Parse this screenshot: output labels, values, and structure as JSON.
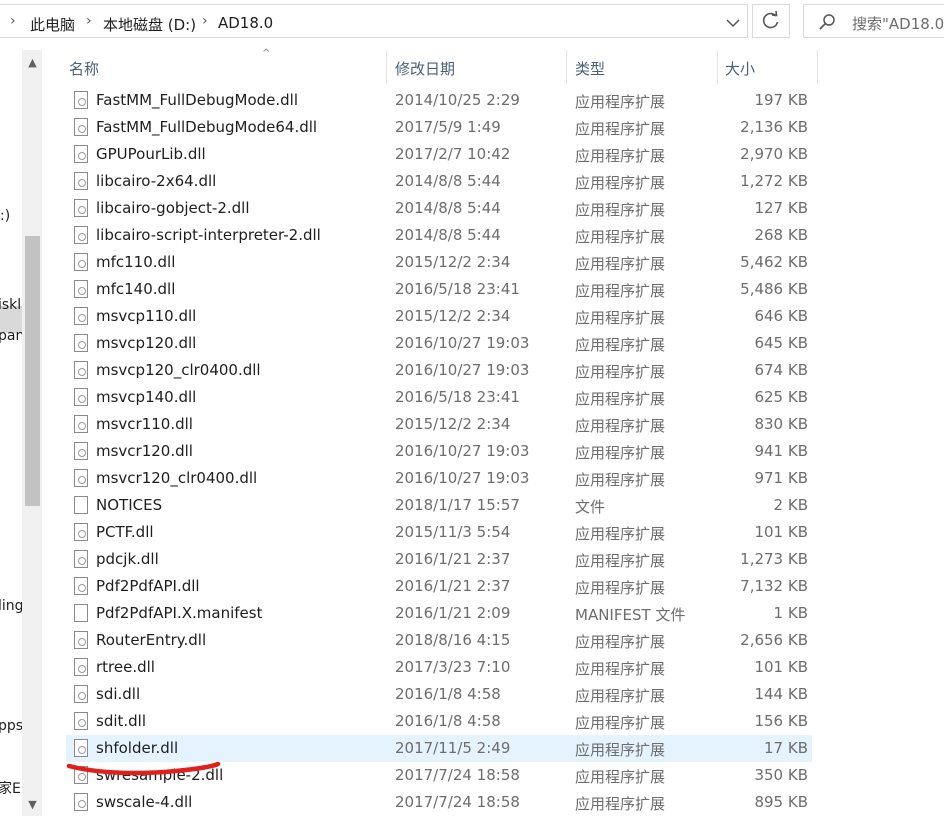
{
  "breadcrumb": {
    "items": [
      "此电脑",
      "本地磁盘 (D:)",
      "AD18.0"
    ]
  },
  "search": {
    "placeholder": "搜索\"AD18.0"
  },
  "nav_fragments": [
    ":)",
    "iskl",
    "pan",
    "ling",
    "pps",
    "家Ε"
  ],
  "columns": {
    "name": "名称",
    "modified": "修改日期",
    "type": "类型",
    "size": "大小"
  },
  "files": [
    {
      "name": "FastMM_FullDebugMode.dll",
      "date": "2014/10/25 2:29",
      "type": "应用程序扩展",
      "size": "197 KB"
    },
    {
      "name": "FastMM_FullDebugMode64.dll",
      "date": "2017/5/9 1:49",
      "type": "应用程序扩展",
      "size": "2,136 KB"
    },
    {
      "name": "GPUPourLib.dll",
      "date": "2017/2/7 10:42",
      "type": "应用程序扩展",
      "size": "2,970 KB"
    },
    {
      "name": "libcairo-2x64.dll",
      "date": "2014/8/8 5:44",
      "type": "应用程序扩展",
      "size": "1,272 KB"
    },
    {
      "name": "libcairo-gobject-2.dll",
      "date": "2014/8/8 5:44",
      "type": "应用程序扩展",
      "size": "127 KB"
    },
    {
      "name": "libcairo-script-interpreter-2.dll",
      "date": "2014/8/8 5:44",
      "type": "应用程序扩展",
      "size": "268 KB"
    },
    {
      "name": "mfc110.dll",
      "date": "2015/12/2 2:34",
      "type": "应用程序扩展",
      "size": "5,462 KB"
    },
    {
      "name": "mfc140.dll",
      "date": "2016/5/18 23:41",
      "type": "应用程序扩展",
      "size": "5,486 KB"
    },
    {
      "name": "msvcp110.dll",
      "date": "2015/12/2 2:34",
      "type": "应用程序扩展",
      "size": "646 KB"
    },
    {
      "name": "msvcp120.dll",
      "date": "2016/10/27 19:03",
      "type": "应用程序扩展",
      "size": "645 KB"
    },
    {
      "name": "msvcp120_clr0400.dll",
      "date": "2016/10/27 19:03",
      "type": "应用程序扩展",
      "size": "674 KB"
    },
    {
      "name": "msvcp140.dll",
      "date": "2016/5/18 23:41",
      "type": "应用程序扩展",
      "size": "625 KB"
    },
    {
      "name": "msvcr110.dll",
      "date": "2015/12/2 2:34",
      "type": "应用程序扩展",
      "size": "830 KB"
    },
    {
      "name": "msvcr120.dll",
      "date": "2016/10/27 19:03",
      "type": "应用程序扩展",
      "size": "941 KB"
    },
    {
      "name": "msvcr120_clr0400.dll",
      "date": "2016/10/27 19:03",
      "type": "应用程序扩展",
      "size": "971 KB"
    },
    {
      "name": "NOTICES",
      "date": "2018/1/17 15:57",
      "type": "文件",
      "size": "2 KB"
    },
    {
      "name": "PCTF.dll",
      "date": "2015/11/3 5:54",
      "type": "应用程序扩展",
      "size": "101 KB"
    },
    {
      "name": "pdcjk.dll",
      "date": "2016/1/21 2:37",
      "type": "应用程序扩展",
      "size": "1,273 KB"
    },
    {
      "name": "Pdf2PdfAPI.dll",
      "date": "2016/1/21 2:37",
      "type": "应用程序扩展",
      "size": "7,132 KB"
    },
    {
      "name": "Pdf2PdfAPI.X.manifest",
      "date": "2016/1/21 2:09",
      "type": "MANIFEST 文件",
      "size": "1 KB"
    },
    {
      "name": "RouterEntry.dll",
      "date": "2018/8/16 4:15",
      "type": "应用程序扩展",
      "size": "2,656 KB"
    },
    {
      "name": "rtree.dll",
      "date": "2017/3/23 7:10",
      "type": "应用程序扩展",
      "size": "101 KB"
    },
    {
      "name": "sdi.dll",
      "date": "2016/1/8 4:58",
      "type": "应用程序扩展",
      "size": "144 KB"
    },
    {
      "name": "sdit.dll",
      "date": "2016/1/8 4:58",
      "type": "应用程序扩展",
      "size": "156 KB"
    },
    {
      "name": "shfolder.dll",
      "date": "2017/11/5 2:49",
      "type": "应用程序扩展",
      "size": "17 KB",
      "selected": true
    },
    {
      "name": "swresample-2.dll",
      "date": "2017/7/24 18:58",
      "type": "应用程序扩展",
      "size": "350 KB"
    },
    {
      "name": "swscale-4.dll",
      "date": "2017/7/24 18:58",
      "type": "应用程序扩展",
      "size": "895 KB"
    }
  ],
  "colors": {
    "accent_underline": "#e0201a",
    "selected_row": "#e5f3ff",
    "header_text": "#4c607a"
  },
  "icons": [
    "dropdown-chevron-icon",
    "refresh-icon",
    "search-icon",
    "scroll-up-arrow-icon",
    "scroll-down-arrow-icon",
    "dll-file-icon",
    "plain-file-icon"
  ]
}
